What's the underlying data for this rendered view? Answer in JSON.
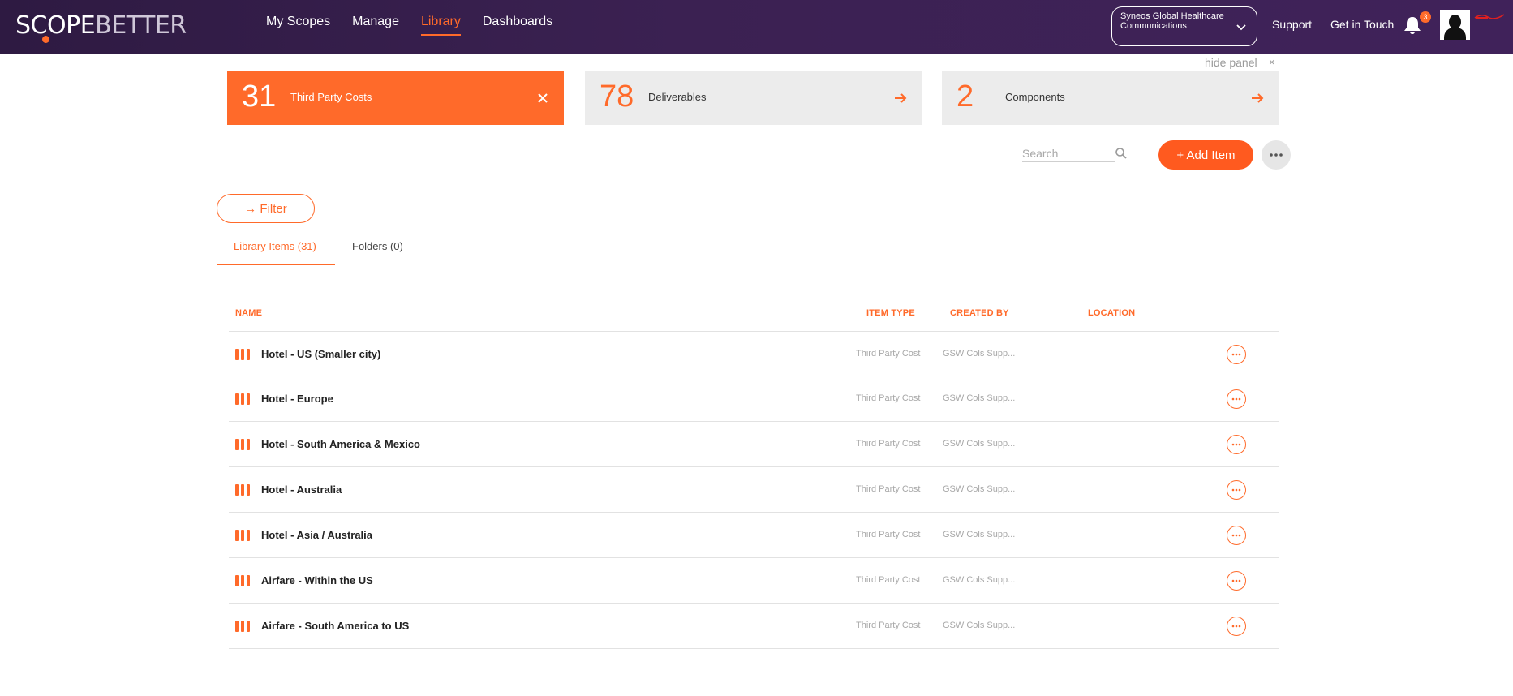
{
  "header": {
    "logo_part1": "SCOPE",
    "logo_part2": "BETTER",
    "nav": [
      "My Scopes",
      "Manage",
      "Library",
      "Dashboards"
    ],
    "active_nav": "Library",
    "org_select_value": "Syneos Global Healthcare Communications",
    "support": "Support",
    "get_in_touch": "Get in Touch",
    "notification_count": "3"
  },
  "panel": {
    "hide_label": "hide panel",
    "hide_close": "×",
    "cards": [
      {
        "count": "31",
        "label": "Third Party Costs",
        "active": true
      },
      {
        "count": "78",
        "label": "Deliverables",
        "active": false
      },
      {
        "count": "2",
        "label": "Components",
        "active": false
      }
    ]
  },
  "toolbar": {
    "search_placeholder": "Search",
    "add_label": "+ Add Item",
    "filter_label": "→ Filter"
  },
  "tabs": [
    {
      "label": "Library Items (31)",
      "active": true
    },
    {
      "label": "Folders (0)",
      "active": false
    }
  ],
  "table": {
    "headers": {
      "name": "NAME",
      "item_type": "ITEM TYPE",
      "created_by": "CREATED BY",
      "location": "LOCATION"
    },
    "rows": [
      {
        "name": "Hotel - US (Smaller city)",
        "type": "Third Party Cost",
        "creator": "GSW Cols Supp..."
      },
      {
        "name": "Hotel - Europe",
        "type": "Third Party Cost",
        "creator": "GSW Cols Supp..."
      },
      {
        "name": "Hotel - South America & Mexico",
        "type": "Third Party Cost",
        "creator": "GSW Cols Supp..."
      },
      {
        "name": "Hotel - Australia",
        "type": "Third Party Cost",
        "creator": "GSW Cols Supp..."
      },
      {
        "name": "Hotel - Asia / Australia",
        "type": "Third Party Cost",
        "creator": "GSW Cols Supp..."
      },
      {
        "name": "Airfare - Within the US",
        "type": "Third Party Cost",
        "creator": "GSW Cols Supp..."
      },
      {
        "name": "Airfare - South America to US",
        "type": "Third Party Cost",
        "creator": "GSW Cols Supp..."
      }
    ]
  },
  "colors": {
    "accent": "#ff6a2a",
    "header_bg": "#3b2152"
  },
  "icons": {
    "org_chevron": "chevron-down-icon",
    "notification": "bell-icon",
    "card_active": "close-icon",
    "card_inactive": "arrow-right-icon",
    "search": "search-icon",
    "more": "more-horizontal-icon",
    "row_type": "bars-icon",
    "row_action": "more-horizontal-icon"
  }
}
